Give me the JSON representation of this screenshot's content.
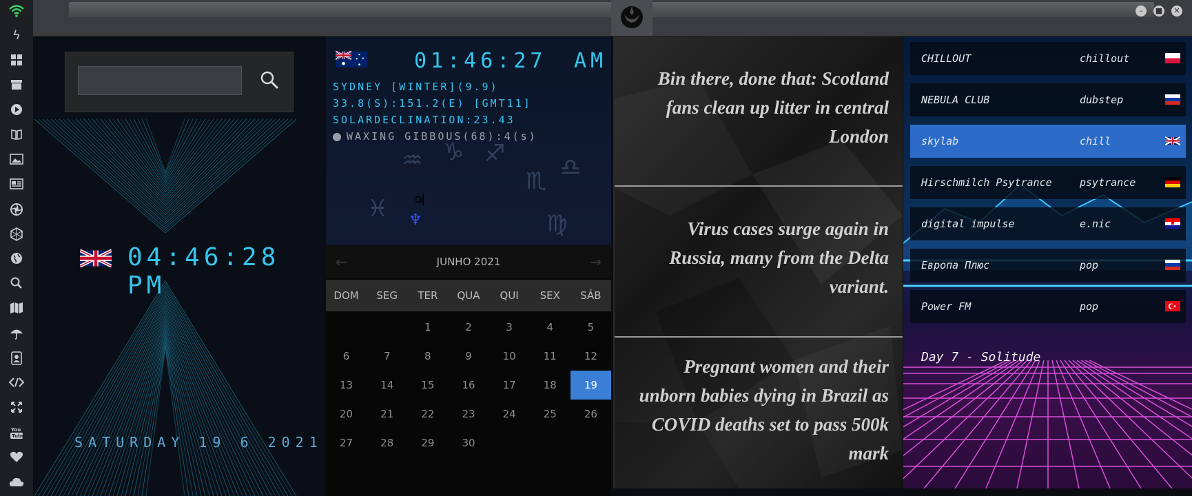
{
  "sidebar": {
    "icons": [
      "wifi-icon",
      "lightning-icon",
      "windows-icon",
      "archive-icon",
      "play-icon",
      "book-icon",
      "image-icon",
      "news-icon",
      "aperture-icon",
      "hexagon-icon",
      "globe-icon",
      "search-icon",
      "map-icon",
      "umbrella-icon",
      "contacts-icon",
      "code-icon",
      "expand-icon",
      "youtube-icon",
      "heart-icon",
      "cloud-icon"
    ]
  },
  "window": {
    "minimize": "–",
    "maximize": "■",
    "close": "✕"
  },
  "search": {
    "value": "",
    "placeholder": ""
  },
  "uk_clock": {
    "time": "04:46:28 PM",
    "date": "SATURDAY 19 6 2021"
  },
  "sydney": {
    "time": "01:46:27",
    "ampm": "AM",
    "line1": "SYDNEY [WINTER](9.9)",
    "line2": "33.8(S):151.2(E) [GMT11]",
    "line3": "SOLARDECLINATION:23.43",
    "moon": "WAXING GIBBOUS(68):4(s)",
    "planet_jupiter": "♃",
    "planet_neptune": "♆"
  },
  "calendar": {
    "title": "JUNHO 2021",
    "prev": "←",
    "next": "→",
    "weekdays": [
      "DOM",
      "SEG",
      "TER",
      "QUA",
      "QUI",
      "SEX",
      "SÁB"
    ],
    "cells": [
      "",
      "",
      "1",
      "2",
      "3",
      "4",
      "5",
      "6",
      "7",
      "8",
      "9",
      "10",
      "11",
      "12",
      "13",
      "14",
      "15",
      "16",
      "17",
      "18",
      "19",
      "20",
      "21",
      "22",
      "23",
      "24",
      "25",
      "26",
      "27",
      "28",
      "29",
      "30",
      "",
      "",
      ""
    ],
    "today": "19"
  },
  "news": [
    "Bin there, done that: Scotland fans clean up litter in central London",
    "Virus cases surge again in Russia, many from the Delta variant.",
    "Pregnant women and their unborn babies dying in Brazil as COVID deaths set to pass 500k mark"
  ],
  "radio": {
    "stations": [
      {
        "name": "CHILLOUT",
        "genre": "chillout",
        "flag": "pl"
      },
      {
        "name": "NEBULA CLUB",
        "genre": "dubstep",
        "flag": "ru"
      },
      {
        "name": "skylab",
        "genre": "chill",
        "flag": "gb"
      },
      {
        "name": "Hirschmilch Psytrance",
        "genre": "psytrance",
        "flag": "de"
      },
      {
        "name": "digital impulse",
        "genre": "e.nic",
        "flag": "hr"
      },
      {
        "name": "Европа Плюс",
        "genre": "pop",
        "flag": "ru"
      },
      {
        "name": "Power FM",
        "genre": "pop",
        "flag": "tr"
      }
    ],
    "active_index": 2,
    "now_playing": "Day 7 - Solitude"
  },
  "colors": {
    "accent_cyan": "#34c6ee",
    "calendar_today": "#3a7fd5",
    "active_station": "#2c6bc8"
  }
}
